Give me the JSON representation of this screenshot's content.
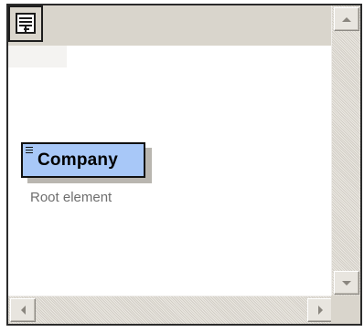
{
  "toolbar": {
    "corner_icon": "document-list-icon"
  },
  "canvas": {
    "node": {
      "label": "Company",
      "caption": "Root element",
      "icon": "element-lines-icon",
      "fill_color": "#a8c8f8"
    }
  },
  "scrollbars": {
    "vertical": {
      "up_icon": "arrow-up-icon",
      "down_icon": "arrow-down-icon"
    },
    "horizontal": {
      "left_icon": "arrow-left-icon",
      "right_icon": "arrow-right-icon"
    }
  }
}
